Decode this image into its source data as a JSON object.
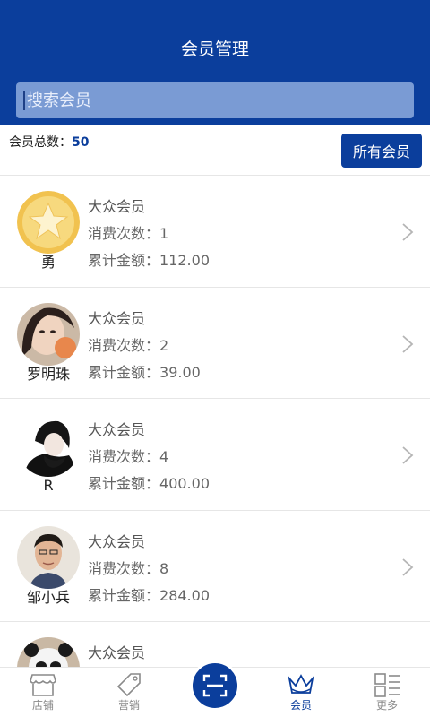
{
  "header": {
    "title": "会员管理"
  },
  "search": {
    "placeholder": "搜索会员"
  },
  "summary": {
    "label": "会员总数：",
    "count": "50",
    "all_button": "所有会员"
  },
  "members": [
    {
      "name": "勇",
      "level": "大众会员",
      "visits_label": "消费次数：",
      "visits": "1",
      "amount_label": "累计金额：",
      "amount": "112.00",
      "avatar": "star-avatar"
    },
    {
      "name": "罗明珠",
      "level": "大众会员",
      "visits_label": "消费次数：",
      "visits": "2",
      "amount_label": "累计金额：",
      "amount": "39.00",
      "avatar": "photo-avatar"
    },
    {
      "name": "R",
      "level": "大众会员",
      "visits_label": "消费次数：",
      "visits": "4",
      "amount_label": "累计金额：",
      "amount": "400.00",
      "avatar": "photo-avatar"
    },
    {
      "name": "邹小兵",
      "level": "大众会员",
      "visits_label": "消费次数：",
      "visits": "8",
      "amount_label": "累计金额：",
      "amount": "284.00",
      "avatar": "photo-avatar"
    },
    {
      "name": "",
      "level": "大众会员",
      "visits_label": "",
      "visits": "",
      "amount_label": "",
      "amount": "",
      "avatar": "panda-avatar"
    }
  ],
  "tabbar": {
    "items": [
      {
        "label": "店铺",
        "icon": "shop-icon"
      },
      {
        "label": "营销",
        "icon": "tag-icon"
      },
      {
        "label": "",
        "icon": "scan-icon"
      },
      {
        "label": "会员",
        "icon": "crown-icon"
      },
      {
        "label": "更多",
        "icon": "more-icon"
      }
    ],
    "active_color": "#0b3e9c"
  },
  "colors": {
    "brand": "#0b3e9c",
    "search_bg": "#7a9bd4"
  }
}
